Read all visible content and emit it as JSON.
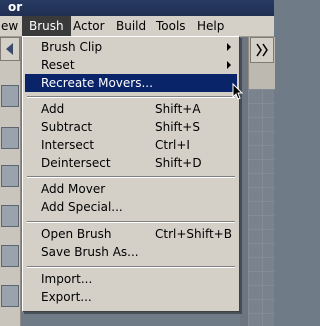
{
  "window": {
    "title_fragment": "or"
  },
  "menubar": {
    "items": [
      {
        "label": "ew"
      },
      {
        "label": "Brush"
      },
      {
        "label": "Actor"
      },
      {
        "label": "Build"
      },
      {
        "label": "Tools"
      },
      {
        "label": "Help"
      }
    ]
  },
  "brush_menu": {
    "items": [
      {
        "label": "Brush Clip",
        "submenu": true
      },
      {
        "label": "Reset",
        "submenu": true
      },
      {
        "label": "Recreate Movers...",
        "highlighted": true
      },
      {
        "label": "Add",
        "shortcut": "Shift+A"
      },
      {
        "label": "Subtract",
        "shortcut": "Shift+S"
      },
      {
        "label": "Intersect",
        "shortcut": "Ctrl+I"
      },
      {
        "label": "Deintersect",
        "shortcut": "Shift+D"
      },
      {
        "label": "Add Mover"
      },
      {
        "label": "Add Special..."
      },
      {
        "label": "Open Brush",
        "shortcut": "Ctrl+Shift+B"
      },
      {
        "label": "Save Brush As..."
      },
      {
        "label": "Import..."
      },
      {
        "label": "Export..."
      }
    ]
  },
  "colors": {
    "menu_bg": "#d4d0c8",
    "highlight": "#0a246a",
    "open_menu_header": "#3a3a3a"
  },
  "icons": [
    "submenu-arrow-icon",
    "mouse-pointer-icon"
  ]
}
